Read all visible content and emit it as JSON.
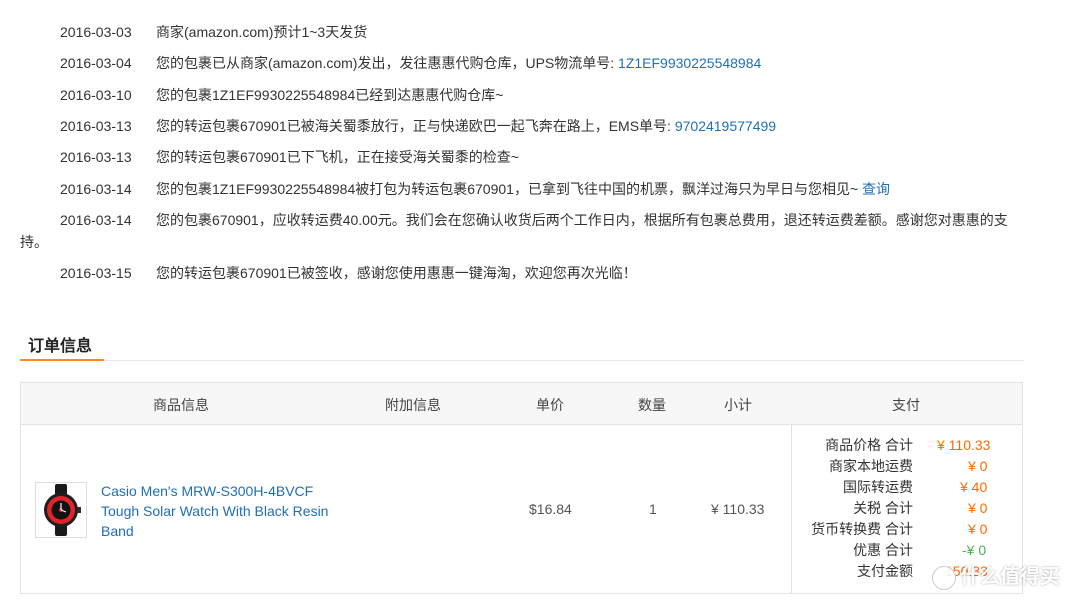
{
  "tracking": [
    {
      "date": "2016-03-03",
      "text": "商家(amazon.com)预计1~3天发货",
      "link": ""
    },
    {
      "date": "2016-03-04",
      "text": "您的包裹已从商家(amazon.com)发出，发往惠惠代购仓库，UPS物流单号: ",
      "link": "1Z1EF9930225548984"
    },
    {
      "date": "2016-03-10",
      "text": "您的包裹1Z1EF9930225548984已经到达惠惠代购仓库~",
      "link": ""
    },
    {
      "date": "2016-03-13",
      "text": "您的转运包裹670901已被海关蜀黍放行，正与快递欧巴一起飞奔在路上，EMS单号: ",
      "link": "9702419577499"
    },
    {
      "date": "2016-03-13",
      "text": "您的转运包裹670901已下飞机，正在接受海关蜀黍的检查~",
      "link": ""
    },
    {
      "date": "2016-03-14",
      "text": "您的包裹1Z1EF9930225548984被打包为转运包裹670901，已拿到飞往中国的机票，飘洋过海只为早日与您相见~ ",
      "link": "查询"
    },
    {
      "date": "2016-03-14",
      "text": "您的包裹670901，应收转运费40.00元。我们会在您确认收货后两个工作日内，根据所有包裹总费用，退还转运费差额。感谢您对惠惠的支持。",
      "link": ""
    },
    {
      "date": "2016-03-15",
      "text": "您的转运包裹670901已被签收，感谢您使用惠惠一键海淘，欢迎您再次光临！",
      "link": ""
    }
  ],
  "order_section": {
    "title": "订单信息"
  },
  "table": {
    "headers": {
      "product": "商品信息",
      "extra": "附加信息",
      "unit_price": "单价",
      "quantity": "数量",
      "subtotal": "小计",
      "payment": "支付"
    },
    "row": {
      "product_name": "Casio Men's MRW-S300H-4BVCF Tough Solar Watch With Black Resin Band",
      "unit_price": "$16.84",
      "quantity": "1",
      "subtotal": "¥ 110.33"
    },
    "payment": [
      {
        "label": "商品价格 合计",
        "value": "¥ 110.33",
        "color": "#ff6a00"
      },
      {
        "label": "商家本地运费",
        "value": "¥ 0",
        "color": "#ff6a00"
      },
      {
        "label": "国际转运费",
        "value": "¥ 40",
        "color": "#ff6a00"
      },
      {
        "label": "关税 合计",
        "value": "¥ 0",
        "color": "#ff6a00"
      },
      {
        "label": "货币转换费 合计",
        "value": "¥ 0",
        "color": "#ff6a00"
      },
      {
        "label": "优惠 合计",
        "value": "-¥ 0",
        "color": "#4caf50"
      },
      {
        "label": "支付金额",
        "value": "150.33",
        "color": "#ff6a00"
      }
    ]
  },
  "watermark": {
    "text": "什么值得买"
  }
}
